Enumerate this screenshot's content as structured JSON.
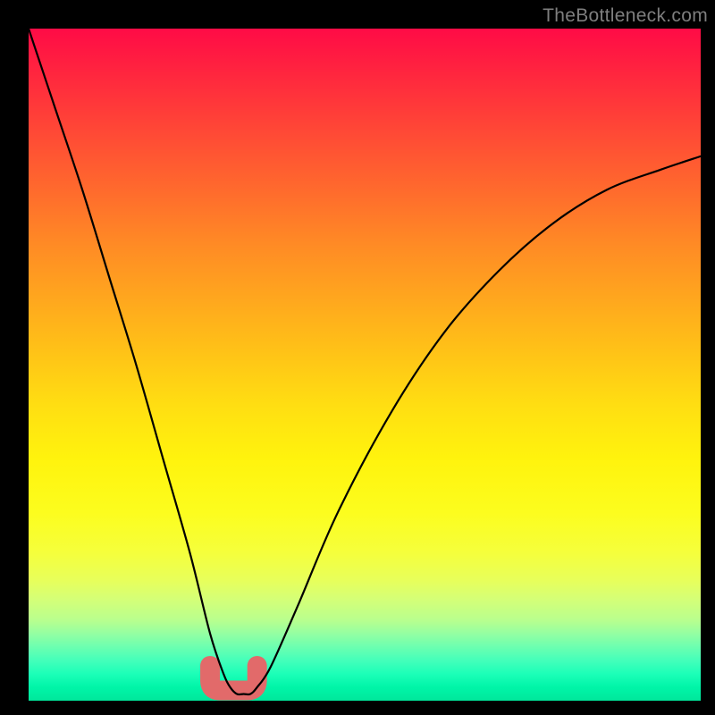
{
  "watermark": "TheBottleneck.com",
  "chart_data": {
    "type": "line",
    "title": "",
    "xlabel": "",
    "ylabel": "",
    "xlim": [
      0,
      100
    ],
    "ylim": [
      0,
      100
    ],
    "grid": false,
    "legend": false,
    "series": [
      {
        "name": "bottleneck-curve",
        "x": [
          0,
          4,
          8,
          12,
          16,
          20,
          24,
          27,
          29,
          30,
          31,
          32,
          33,
          34,
          36,
          40,
          46,
          54,
          62,
          70,
          78,
          86,
          94,
          100
        ],
        "y": [
          100,
          88,
          76,
          63,
          50,
          36,
          22,
          10,
          4,
          2,
          1,
          1,
          1,
          2,
          5,
          14,
          28,
          43,
          55,
          64,
          71,
          76,
          79,
          81
        ]
      }
    ],
    "annotations": [
      {
        "name": "optimal-range-marker",
        "x_start": 27,
        "x_end": 34,
        "y": 3
      }
    ]
  }
}
